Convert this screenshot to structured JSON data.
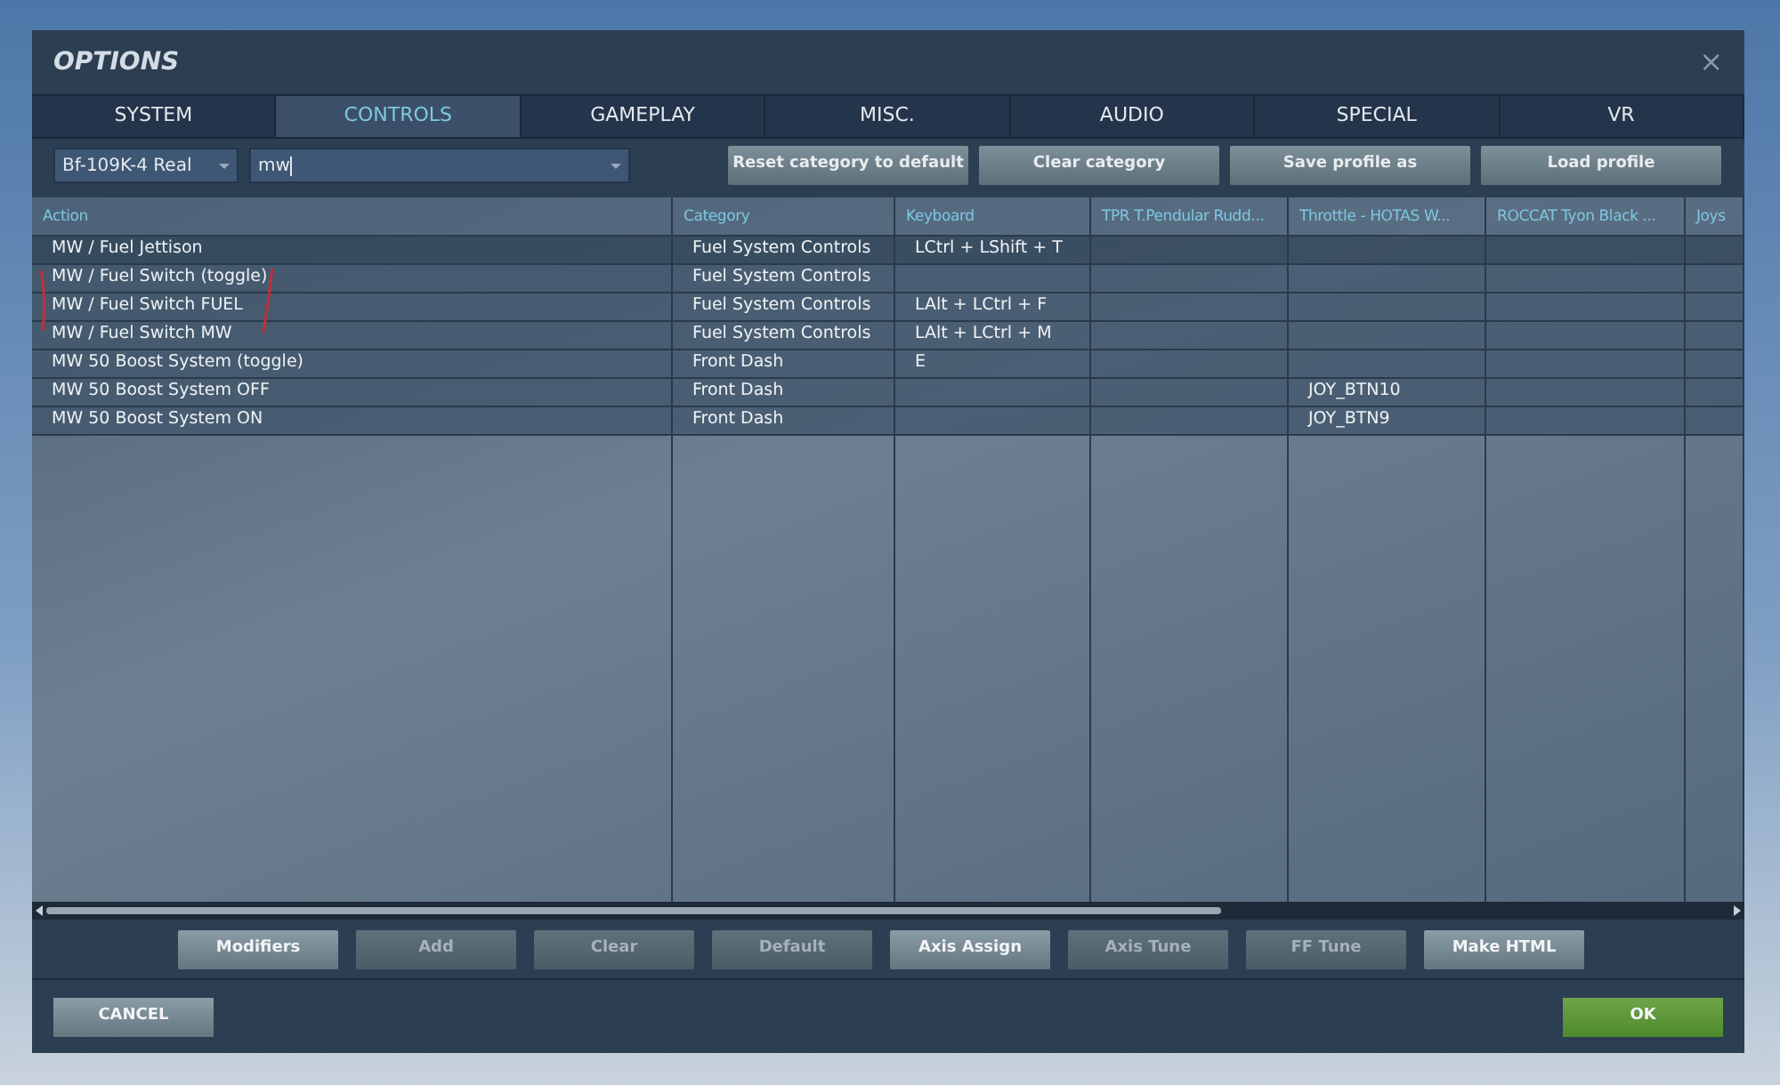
{
  "window": {
    "title": "OPTIONS",
    "close": "×"
  },
  "tabs": [
    {
      "label": "SYSTEM",
      "selected": false
    },
    {
      "label": "CONTROLS",
      "selected": true
    },
    {
      "label": "GAMEPLAY",
      "selected": false
    },
    {
      "label": "MISC.",
      "selected": false
    },
    {
      "label": "AUDIO",
      "selected": false
    },
    {
      "label": "SPECIAL",
      "selected": false
    },
    {
      "label": "VR",
      "selected": false
    }
  ],
  "toolbar": {
    "aircraft": "Bf-109K-4 Real",
    "filter": "mw",
    "buttons": [
      "Reset category to default",
      "Clear category",
      "Save profile as",
      "Load profile"
    ]
  },
  "table": {
    "columns": [
      "Action",
      "Category",
      "Keyboard",
      "TPR T.Pendular Rudd...",
      "Throttle - HOTAS W...",
      "ROCCAT Tyon Black ...",
      "Joys"
    ],
    "rows": [
      {
        "selected": true,
        "cells": [
          "MW / Fuel Jettison",
          "Fuel System Controls",
          "LCtrl + LShift + T",
          "",
          "",
          "",
          ""
        ]
      },
      {
        "selected": false,
        "cells": [
          "MW / Fuel Switch (toggle)",
          "Fuel System Controls",
          "",
          "",
          "",
          "",
          ""
        ]
      },
      {
        "selected": false,
        "cells": [
          "MW / Fuel Switch FUEL",
          "Fuel System Controls",
          "LAlt + LCtrl + F",
          "",
          "",
          "",
          ""
        ]
      },
      {
        "selected": false,
        "cells": [
          "MW / Fuel Switch MW",
          "Fuel System Controls",
          "LAlt + LCtrl + M",
          "",
          "",
          "",
          ""
        ]
      },
      {
        "selected": false,
        "cells": [
          "MW 50 Boost System (toggle)",
          "Front Dash",
          "E",
          "",
          "",
          "",
          ""
        ]
      },
      {
        "selected": false,
        "cells": [
          "MW 50 Boost System OFF",
          "Front Dash",
          "",
          "",
          "JOY_BTN10",
          "",
          ""
        ]
      },
      {
        "selected": false,
        "cells": [
          "MW 50 Boost System ON",
          "Front Dash",
          "",
          "",
          "JOY_BTN9",
          "",
          ""
        ]
      }
    ]
  },
  "actions": [
    {
      "label": "Modifiers",
      "disabled": false
    },
    {
      "label": "Add",
      "disabled": true
    },
    {
      "label": "Clear",
      "disabled": true
    },
    {
      "label": "Default",
      "disabled": true
    },
    {
      "label": "Axis Assign",
      "disabled": false
    },
    {
      "label": "Axis Tune",
      "disabled": true
    },
    {
      "label": "FF Tune",
      "disabled": true
    },
    {
      "label": "Make HTML",
      "disabled": false
    }
  ],
  "footer": {
    "cancel": "CANCEL",
    "ok": "OK"
  }
}
